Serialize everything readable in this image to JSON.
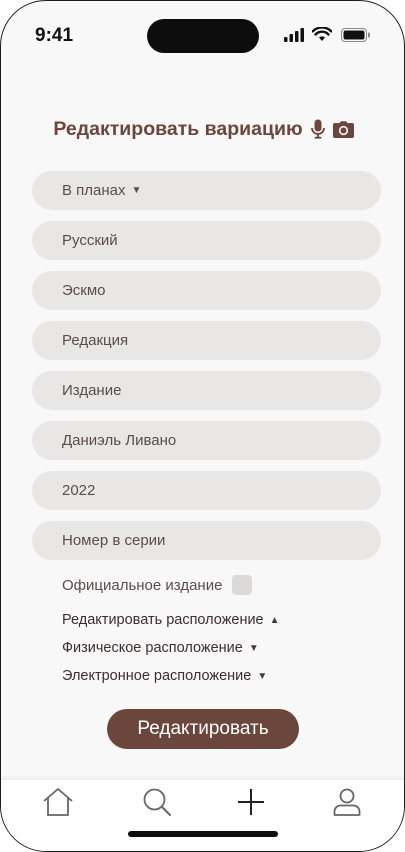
{
  "status_bar": {
    "time": "9:41"
  },
  "header": {
    "title": "Редактировать вариацию"
  },
  "form": {
    "status_select": "В планах",
    "language": "Русский",
    "publisher": "Эскмо",
    "edition_placeholder": "Редакция",
    "release_placeholder": "Издание",
    "author": "Даниэль Ливано",
    "year": "2022",
    "series_number_placeholder": "Номер в серии",
    "official_label": "Официальное издание",
    "official_checked": false
  },
  "locations": {
    "edit_label": "Редактировать расположение",
    "physical_label": "Физическое расположение",
    "electronic_label": "Электронное расположение"
  },
  "actions": {
    "submit_label": "Редактировать"
  },
  "tabbar": {
    "tabs": [
      "home-icon",
      "search-icon",
      "add-icon",
      "profile-icon"
    ]
  },
  "colors": {
    "accent": "#6b463d",
    "field_bg": "#e9e7e5",
    "background": "#f9f8f8"
  }
}
